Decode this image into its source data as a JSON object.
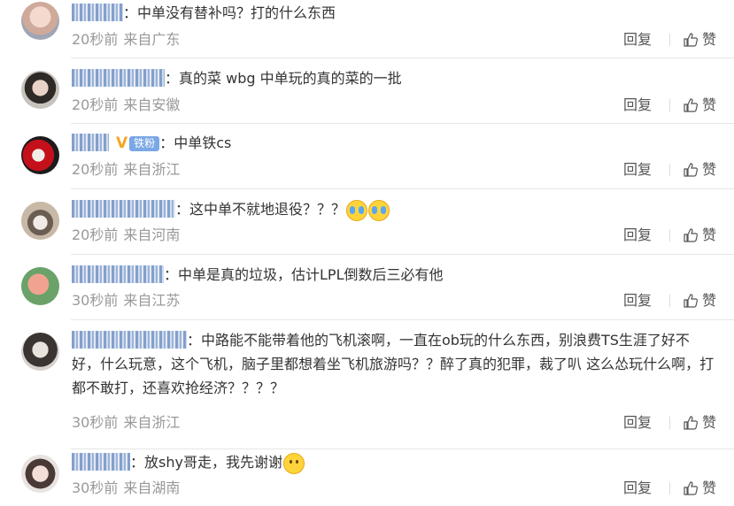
{
  "comments": [
    {
      "text": "中单没有替补吗？打的什么东西",
      "time": "20秒前",
      "from": "来自广东",
      "badge": false,
      "emojis": []
    },
    {
      "text": "真的菜 wbg 中单玩的真的菜的一批",
      "time": "20秒前",
      "from": "来自安徽",
      "badge": false,
      "emojis": []
    },
    {
      "text": "中单铁cs",
      "time": "20秒前",
      "from": "来自浙江",
      "badge": true,
      "emojis": []
    },
    {
      "text": "这中单不就地退役？？？",
      "time": "20秒前",
      "from": "来自河南",
      "badge": false,
      "emojis": [
        "cry",
        "cry"
      ]
    },
    {
      "text": "中单是真的垃圾，估计LPL倒数后三必有他",
      "time": "30秒前",
      "from": "来自江苏",
      "badge": false,
      "emojis": []
    },
    {
      "text": "中路能不能带着他的飞机滚啊，一直在ob玩的什么东西，别浪费TS生涯了好不好，什么玩意，这个飞机，脑子里都想着坐飞机旅游吗？？醉了真的犯罪，裁了叭 这么怂玩什么啊，打都不敢打，还喜欢抢经济？？？？",
      "time": "30秒前",
      "from": "来自浙江",
      "badge": false,
      "emojis": []
    },
    {
      "text": "放shy哥走，我先谢谢",
      "time": "30秒前",
      "from": "来自湖南",
      "badge": false,
      "emojis": [
        "smile"
      ]
    }
  ],
  "ui": {
    "reply_label": "回复",
    "like_label": "赞",
    "fan_badge": "铁粉",
    "colon": "："
  },
  "colors": {
    "meta": "#999999",
    "text": "#333333",
    "username_blur": "#6d8fc3",
    "fan_badge": "#7aa7e5",
    "v_badge": "#f6a623"
  }
}
